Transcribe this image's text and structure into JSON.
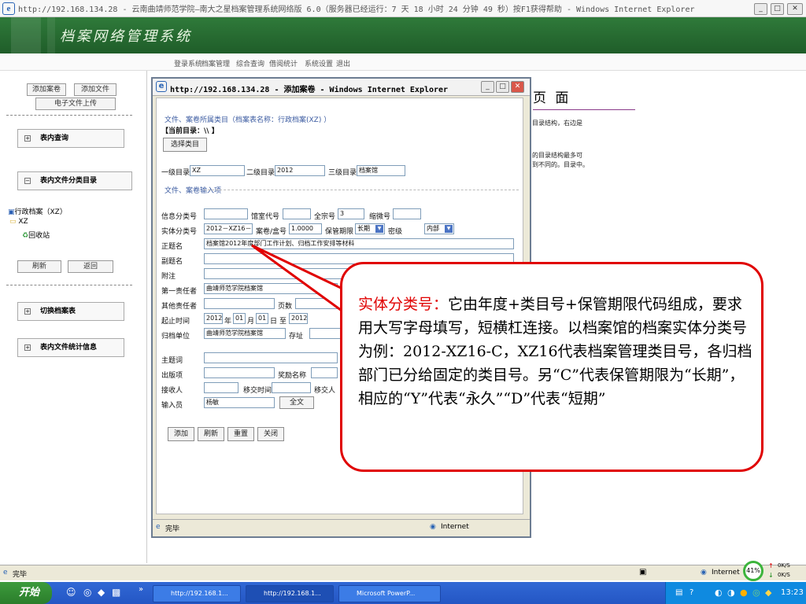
{
  "window": {
    "title": "http://192.168.134.28 - 云南曲靖师范学院—南大之星档案管理系统网络版 6.0（服务器已经运行：7 天 18 小时 24 分钟 49 秒）按F1获得帮助 - Windows Internet Explorer"
  },
  "app": {
    "title": "档案网络管理系统",
    "nav": [
      "登录系统",
      "档案管理",
      "综合查询",
      "借阅统计",
      "系统设置",
      "退出"
    ]
  },
  "sidebar": {
    "buttons": {
      "add_volume": "添加案卷",
      "add_file": "添加文件",
      "upload": "电子文件上传"
    },
    "sections": {
      "table_query": "表内查询",
      "category_dir": "表内文件分类目录",
      "switch_table": "切换档案表",
      "stats": "表内文件统计信息"
    },
    "tree": {
      "root": "行政档案（XZ）",
      "child": "XZ",
      "recycle": "回收站"
    },
    "actions": {
      "refresh": "刷新",
      "back": "返回"
    }
  },
  "page": {
    "heading": "页 面",
    "lines": [
      "目录结构，右边是",
      "的目录结构最多可",
      "到不同的。目录中。"
    ]
  },
  "popup": {
    "title": "http://192.168.134.28 - 添加案卷 - Windows Internet Explorer",
    "category_line": "文件、案卷所属类目（档案表名称：行政档案(XZ) ）",
    "current_dir": "【当前目录：\\\\ 】",
    "select_category": "选择类目",
    "level1_label": "一级目录",
    "level1_value": "XZ",
    "level2_label": "二级目录",
    "level2_value": "2012",
    "level3_label": "三级目录",
    "level3_value": "档案馆",
    "input_section": "文件、案卷输入项",
    "info_class": "信息分类号",
    "hall_code": "馆室代号",
    "fonds_label": "全宗号",
    "fonds_value": "3",
    "microfilm": "缩微号",
    "entity_label": "实体分类号",
    "entity_value": "2012－XZ16－C",
    "volume_label": "案卷/盒号",
    "volume_value": "1.0000",
    "retention_label": "保管期限",
    "retention_value": "长期",
    "secret_label": "密级",
    "secret_value": "内部",
    "title_label": "正题名",
    "title_value": "档案馆2012年度部门工作计划、归档工作安排等材料",
    "subtitle_label": "副题名",
    "note_label": "附注",
    "resp1_label": "第一责任者",
    "resp1_value": "曲靖师范学院档案馆",
    "resp_other_label": "其他责任者",
    "pages_label": "页数",
    "date_label": "起止时间",
    "date_from": "2012",
    "year": "年",
    "m_from": "01",
    "month": "月",
    "d_from": "01",
    "day": "日",
    "to": "至",
    "date_to": "2012",
    "unit_label": "归档单位",
    "unit_value": "曲靖师范学院档案馆",
    "location_label": "存址",
    "keyword_label": "主题词",
    "publish_label": "出版项",
    "award_label": "奖励名称",
    "receiver_label": "接收人",
    "transfer_time_label": "移交时间",
    "transferrer_label": "移交人",
    "operator_label": "输入员",
    "operator_value": "杨敏",
    "fulltext": "全文",
    "btn_add": "添加",
    "btn_refresh": "刷新",
    "btn_reset": "重置",
    "btn_close": "关闭",
    "status_done": "完毕",
    "status_zone": "Internet"
  },
  "callout": {
    "keyword": "实体分类号：",
    "text": "它由年度+类目号+保管期限代码组成，要求用大写字母填写，短横杠连接。以档案馆的档案实体分类号为例：2012-XZ16-C，XZ16代表档案管理类目号，各归档部门已分给固定的类目号。另“C”代表保管期限为“长期”，相应的“Y”代表“永久”“D”代表“短期”"
  },
  "statusbar": {
    "done": "完毕",
    "zone": "Internet",
    "percent": "41%",
    "up": "0K/S",
    "down": "0K/S"
  },
  "taskbar": {
    "start": "开始",
    "tasks": [
      "http://192.168.1...",
      "http://192.168.1...",
      "Microsoft PowerP..."
    ],
    "clock": "13:23"
  }
}
